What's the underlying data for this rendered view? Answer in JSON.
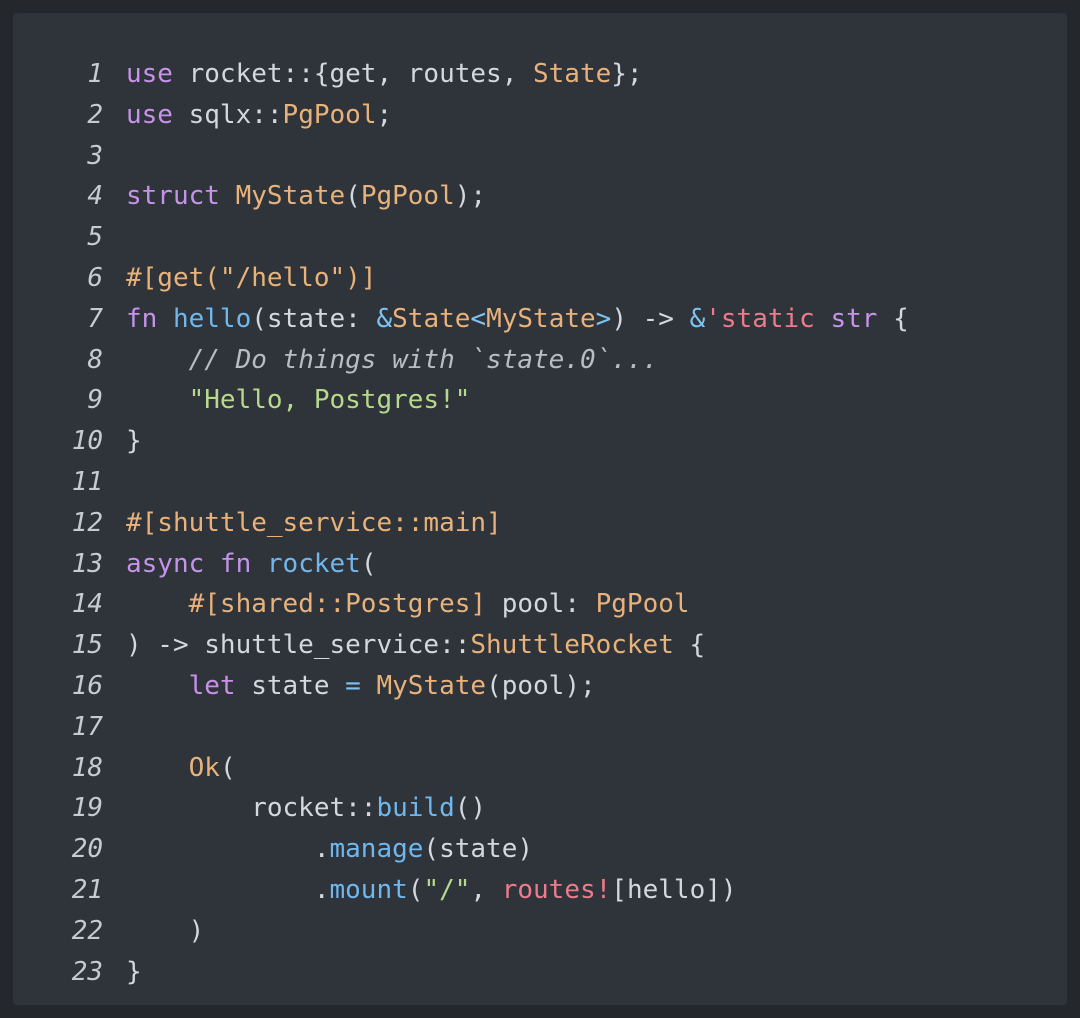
{
  "colors": {
    "page_background": "#24272b",
    "editor_background": "#2f333a",
    "line_number": "#c7cbd1",
    "plain": "#d3d7de",
    "keyword": "#c792ea",
    "type": "#e8b27a",
    "function": "#6fb7ec",
    "string": "#b6d98c",
    "comment": "#b8bcc4",
    "macro": "#ec7c8b"
  },
  "editor": {
    "lines": [
      {
        "number": "1",
        "tokens": [
          {
            "t": "use",
            "c": "keyword"
          },
          {
            "t": " rocket::{get, routes, ",
            "c": "plain"
          },
          {
            "t": "State",
            "c": "type"
          },
          {
            "t": "};",
            "c": "plain"
          }
        ]
      },
      {
        "number": "2",
        "tokens": [
          {
            "t": "use",
            "c": "keyword"
          },
          {
            "t": " sqlx::",
            "c": "plain"
          },
          {
            "t": "PgPool",
            "c": "type"
          },
          {
            "t": ";",
            "c": "plain"
          }
        ]
      },
      {
        "number": "3",
        "tokens": []
      },
      {
        "number": "4",
        "tokens": [
          {
            "t": "struct",
            "c": "keyword"
          },
          {
            "t": " ",
            "c": "plain"
          },
          {
            "t": "MyState",
            "c": "type"
          },
          {
            "t": "(",
            "c": "plain"
          },
          {
            "t": "PgPool",
            "c": "type"
          },
          {
            "t": ");",
            "c": "plain"
          }
        ]
      },
      {
        "number": "5",
        "tokens": []
      },
      {
        "number": "6",
        "tokens": [
          {
            "t": "#[get(\"/hello\")]",
            "c": "attr"
          }
        ]
      },
      {
        "number": "7",
        "tokens": [
          {
            "t": "fn",
            "c": "keyword"
          },
          {
            "t": " ",
            "c": "plain"
          },
          {
            "t": "hello",
            "c": "func"
          },
          {
            "t": "(state: ",
            "c": "plain"
          },
          {
            "t": "&",
            "c": "op"
          },
          {
            "t": "State",
            "c": "type"
          },
          {
            "t": "<",
            "c": "op"
          },
          {
            "t": "MyState",
            "c": "type"
          },
          {
            "t": ">",
            "c": "op"
          },
          {
            "t": ") -> ",
            "c": "plain"
          },
          {
            "t": "&",
            "c": "op"
          },
          {
            "t": "'static",
            "c": "macro"
          },
          {
            "t": " ",
            "c": "plain"
          },
          {
            "t": "str",
            "c": "keyword"
          },
          {
            "t": " {",
            "c": "plain"
          }
        ]
      },
      {
        "number": "8",
        "tokens": [
          {
            "t": "    ",
            "c": "plain"
          },
          {
            "t": "// Do things with `state.0`...",
            "c": "comment"
          }
        ]
      },
      {
        "number": "9",
        "tokens": [
          {
            "t": "    ",
            "c": "plain"
          },
          {
            "t": "\"Hello, Postgres!\"",
            "c": "string"
          }
        ]
      },
      {
        "number": "10",
        "tokens": [
          {
            "t": "}",
            "c": "plain"
          }
        ]
      },
      {
        "number": "11",
        "tokens": []
      },
      {
        "number": "12",
        "tokens": [
          {
            "t": "#[shuttle_service::main]",
            "c": "attr"
          }
        ]
      },
      {
        "number": "13",
        "tokens": [
          {
            "t": "async",
            "c": "keyword"
          },
          {
            "t": " ",
            "c": "plain"
          },
          {
            "t": "fn",
            "c": "keyword"
          },
          {
            "t": " ",
            "c": "plain"
          },
          {
            "t": "rocket",
            "c": "func"
          },
          {
            "t": "(",
            "c": "plain"
          }
        ]
      },
      {
        "number": "14",
        "tokens": [
          {
            "t": "    ",
            "c": "plain"
          },
          {
            "t": "#[shared::Postgres]",
            "c": "attr"
          },
          {
            "t": " pool: ",
            "c": "plain"
          },
          {
            "t": "PgPool",
            "c": "type"
          }
        ]
      },
      {
        "number": "15",
        "tokens": [
          {
            "t": ") -> shuttle_service::",
            "c": "plain"
          },
          {
            "t": "ShuttleRocket",
            "c": "type"
          },
          {
            "t": " {",
            "c": "plain"
          }
        ]
      },
      {
        "number": "16",
        "tokens": [
          {
            "t": "    ",
            "c": "plain"
          },
          {
            "t": "let",
            "c": "keyword"
          },
          {
            "t": " state ",
            "c": "plain"
          },
          {
            "t": "=",
            "c": "op"
          },
          {
            "t": " ",
            "c": "plain"
          },
          {
            "t": "MyState",
            "c": "type"
          },
          {
            "t": "(pool);",
            "c": "plain"
          }
        ]
      },
      {
        "number": "17",
        "tokens": []
      },
      {
        "number": "18",
        "tokens": [
          {
            "t": "    ",
            "c": "plain"
          },
          {
            "t": "Ok",
            "c": "type"
          },
          {
            "t": "(",
            "c": "plain"
          }
        ]
      },
      {
        "number": "19",
        "tokens": [
          {
            "t": "        rocket::",
            "c": "plain"
          },
          {
            "t": "build",
            "c": "func"
          },
          {
            "t": "()",
            "c": "plain"
          }
        ]
      },
      {
        "number": "20",
        "tokens": [
          {
            "t": "            .",
            "c": "plain"
          },
          {
            "t": "manage",
            "c": "func"
          },
          {
            "t": "(state)",
            "c": "plain"
          }
        ]
      },
      {
        "number": "21",
        "tokens": [
          {
            "t": "            .",
            "c": "plain"
          },
          {
            "t": "mount",
            "c": "func"
          },
          {
            "t": "(",
            "c": "plain"
          },
          {
            "t": "\"/\"",
            "c": "string"
          },
          {
            "t": ", ",
            "c": "plain"
          },
          {
            "t": "routes!",
            "c": "macro"
          },
          {
            "t": "[hello])",
            "c": "plain"
          }
        ]
      },
      {
        "number": "22",
        "tokens": [
          {
            "t": "    )",
            "c": "plain"
          }
        ]
      },
      {
        "number": "23",
        "tokens": [
          {
            "t": "}",
            "c": "plain"
          }
        ]
      }
    ]
  }
}
